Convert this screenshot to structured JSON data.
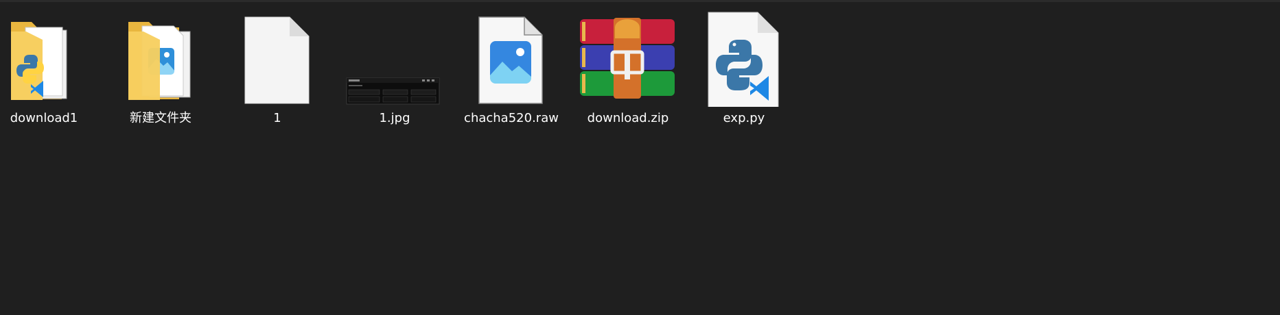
{
  "files": [
    {
      "name": "download1",
      "kind": "folder",
      "icon": "folder-python-icon"
    },
    {
      "name": "新建文件夹",
      "kind": "folder",
      "icon": "folder-image-icon"
    },
    {
      "name": "1",
      "kind": "file",
      "icon": "blank-file-icon"
    },
    {
      "name": "1.jpg",
      "kind": "image",
      "icon": "image-thumbnail"
    },
    {
      "name": "chacha520.raw",
      "kind": "image-file",
      "icon": "photo-file-icon"
    },
    {
      "name": "download.zip",
      "kind": "archive",
      "icon": "winrar-archive-icon"
    },
    {
      "name": "exp.py",
      "kind": "python-file",
      "icon": "python-file-icon"
    }
  ],
  "colors": {
    "background": "#1f1f1f",
    "label_text": "#ffffff",
    "folder_yellow": "#f4c855",
    "python_blue": "#3b77a8",
    "python_yellow": "#ffd342",
    "vscode_blue": "#1e88e5"
  }
}
